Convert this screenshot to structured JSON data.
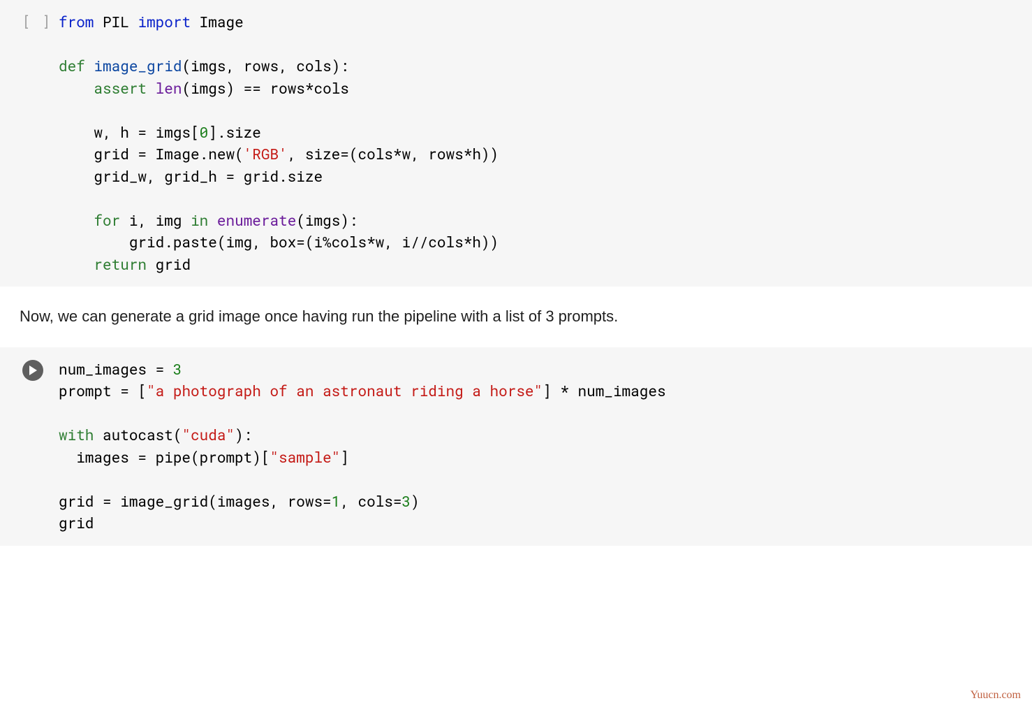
{
  "cell1": {
    "gutter": "[ ]",
    "tokens": [
      [
        {
          "t": "from",
          "c": "kw"
        },
        {
          "t": " PIL "
        },
        {
          "t": "import",
          "c": "kw"
        },
        {
          "t": " Image"
        }
      ],
      [],
      [
        {
          "t": "def",
          "c": "kw2"
        },
        {
          "t": " "
        },
        {
          "t": "image_grid",
          "c": "fn"
        },
        {
          "t": "(imgs, rows, cols):"
        }
      ],
      [
        {
          "t": "    "
        },
        {
          "t": "assert",
          "c": "kw2"
        },
        {
          "t": " "
        },
        {
          "t": "len",
          "c": "builtin"
        },
        {
          "t": "(imgs) == rows*cols"
        }
      ],
      [],
      [
        {
          "t": "    w, h = imgs["
        },
        {
          "t": "0",
          "c": "num"
        },
        {
          "t": "].size"
        }
      ],
      [
        {
          "t": "    grid = Image.new("
        },
        {
          "t": "'RGB'",
          "c": "str"
        },
        {
          "t": ", size=(cols*w, rows*h))"
        }
      ],
      [
        {
          "t": "    grid_w, grid_h = grid.size"
        }
      ],
      [],
      [
        {
          "t": "    "
        },
        {
          "t": "for",
          "c": "kw2"
        },
        {
          "t": " i, img "
        },
        {
          "t": "in",
          "c": "kw2"
        },
        {
          "t": " "
        },
        {
          "t": "enumerate",
          "c": "builtin"
        },
        {
          "t": "(imgs):"
        }
      ],
      [
        {
          "t": "        grid.paste(img, box=(i%cols*w, i//cols*h))"
        }
      ],
      [
        {
          "t": "    "
        },
        {
          "t": "return",
          "c": "kw2"
        },
        {
          "t": " grid"
        }
      ]
    ]
  },
  "markdown_text": "Now, we can generate a grid image once having run the pipeline with a list of 3 prompts.",
  "cell2": {
    "tokens": [
      [
        {
          "t": "num_images = "
        },
        {
          "t": "3",
          "c": "num"
        }
      ],
      [
        {
          "t": "prompt = ["
        },
        {
          "t": "\"a photograph of an astronaut riding a horse\"",
          "c": "str"
        },
        {
          "t": "] * num_images"
        }
      ],
      [],
      [
        {
          "t": "with",
          "c": "kw2"
        },
        {
          "t": " autocast("
        },
        {
          "t": "\"cuda\"",
          "c": "str"
        },
        {
          "t": "):"
        }
      ],
      [
        {
          "t": "  images = pipe(prompt)["
        },
        {
          "t": "\"sample\"",
          "c": "str"
        },
        {
          "t": "]"
        }
      ],
      [],
      [
        {
          "t": "grid = image_grid(images, rows="
        },
        {
          "t": "1",
          "c": "num"
        },
        {
          "t": ", cols="
        },
        {
          "t": "3",
          "c": "num"
        },
        {
          "t": ")"
        }
      ],
      [
        {
          "t": "grid"
        }
      ]
    ]
  },
  "watermark": "Yuucn.com"
}
